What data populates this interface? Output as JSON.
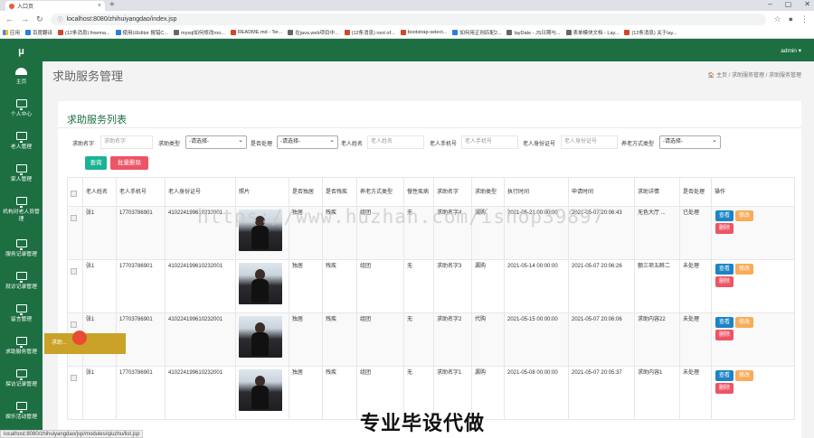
{
  "browser": {
    "tab_title": "入口页",
    "url": "localhost:8080/zhihuiyangdao/index.jsp",
    "bookmarks": [
      "应用",
      "百度翻译",
      "(12条消息) freema...",
      "使用UEditor 报错C...",
      "mysql如何修改roo...",
      "README.md - Ter...",
      "在java web项目中...",
      "(12条消息) root of...",
      "bootstrap-select...",
      "如何用正则匹配2...",
      "layDate - JS日期与...",
      "表单模块文档 - Lay...",
      "(12条消息) 关于lay..."
    ],
    "status_url": "localhost:8080/zhihuiyangdao/jsp/modules/qiuzhu/list.jsp"
  },
  "header": {
    "user": "admin ▾"
  },
  "sidebar": {
    "logo": "μ",
    "items": [
      {
        "label": "主页",
        "icon": "dashboard-icon"
      },
      {
        "label": "个人中心",
        "icon": "monitor-icon"
      },
      {
        "label": "老人管理",
        "icon": "monitor-icon"
      },
      {
        "label": "家人管理",
        "icon": "monitor-icon"
      },
      {
        "label": "机构对老人员管理",
        "icon": "monitor-icon"
      },
      {
        "label": "服务记录管理",
        "icon": "monitor-icon"
      },
      {
        "label": "就诊记录管理",
        "icon": "monitor-icon"
      },
      {
        "label": "留言管理",
        "icon": "monitor-icon"
      },
      {
        "label": "求助服务管理",
        "icon": "monitor-icon"
      },
      {
        "label": "探访记录管理",
        "icon": "monitor-icon"
      },
      {
        "label": "娱乐活动管理",
        "icon": "monitor-icon"
      }
    ],
    "tooltip": "求助..."
  },
  "page": {
    "title": "求助服务管理",
    "breadcrumb": "🏠 主页 / 求助服务管理 / 求助服务管理",
    "list_title": "求助服务列表"
  },
  "filters": {
    "name_label": "求助名字",
    "name_placeholder": "求助名字",
    "type_label": "求助类型",
    "type_value": "-请选择-",
    "processed_label": "是否处理",
    "processed_value": "-请选择-",
    "elder_label": "老人姓名",
    "elder_placeholder": "老人姓名",
    "phone_label": "老人手机号",
    "phone_placeholder": "老人手机号",
    "idcard_label": "老人身份证号",
    "idcard_placeholder": "老人身份证号",
    "care_label": "养老方式类型",
    "care_value": "-请选择-",
    "search_btn": "查询",
    "batch_delete_btn": "批量删除"
  },
  "table": {
    "headers": [
      "",
      "老人姓名",
      "老人手机号",
      "老人身份证号",
      "照片",
      "是否独居",
      "是否残疾",
      "养老方式类型",
      "慢性疾病",
      "求助名字",
      "求助类型",
      "执行时间",
      "申请时间",
      "求助详情",
      "是否处理",
      "操作"
    ],
    "rows": [
      {
        "name": "张1",
        "phone": "17703786901",
        "idcard": "410224199610232001",
        "alone": "独居",
        "disabled": "残疾",
        "care": "组团",
        "chronic": "无",
        "help_name": "求助名字4",
        "help_type": "漏购",
        "exec_time": "2021-05-21 00:00:00",
        "apply_time": "2021-05-07 20:06:43",
        "detail": "无色大厅 ...",
        "processed": "已处理"
      },
      {
        "name": "张1",
        "phone": "17703786901",
        "idcard": "410224199610232001",
        "alone": "独居",
        "disabled": "残疾",
        "care": "组团",
        "chronic": "无",
        "help_name": "求助名字3",
        "help_type": "漏购",
        "exec_time": "2021-05-14 00:00:00",
        "apply_time": "2021-05-07 20:06:26",
        "detail": "额三项五醉二",
        "processed": "未处理"
      },
      {
        "name": "张1",
        "phone": "17703786901",
        "idcard": "410224199610232001",
        "alone": "独居",
        "disabled": "残疾",
        "care": "组团",
        "chronic": "无",
        "help_name": "求助名字2",
        "help_type": "代购",
        "exec_time": "2021-05-15 00:00:00",
        "apply_time": "2021-05-07 20:06:06",
        "detail": "求助内容22",
        "processed": "未处理"
      },
      {
        "name": "张1",
        "phone": "17703786901",
        "idcard": "410224199610232001",
        "alone": "独居",
        "disabled": "残疾",
        "care": "组团",
        "chronic": "无",
        "help_name": "求助名字1",
        "help_type": "漏购",
        "exec_time": "2021-05-08 00:00:00",
        "apply_time": "2021-05-07 20:05:37",
        "detail": "求助内容1",
        "processed": "未处理"
      }
    ],
    "view_btn": "查看",
    "edit_btn": "修改",
    "delete_btn": "删除"
  },
  "overlay": {
    "watermark": "https://www.huzhan.com/ishop39897",
    "banner": "专业毕设代做"
  }
}
